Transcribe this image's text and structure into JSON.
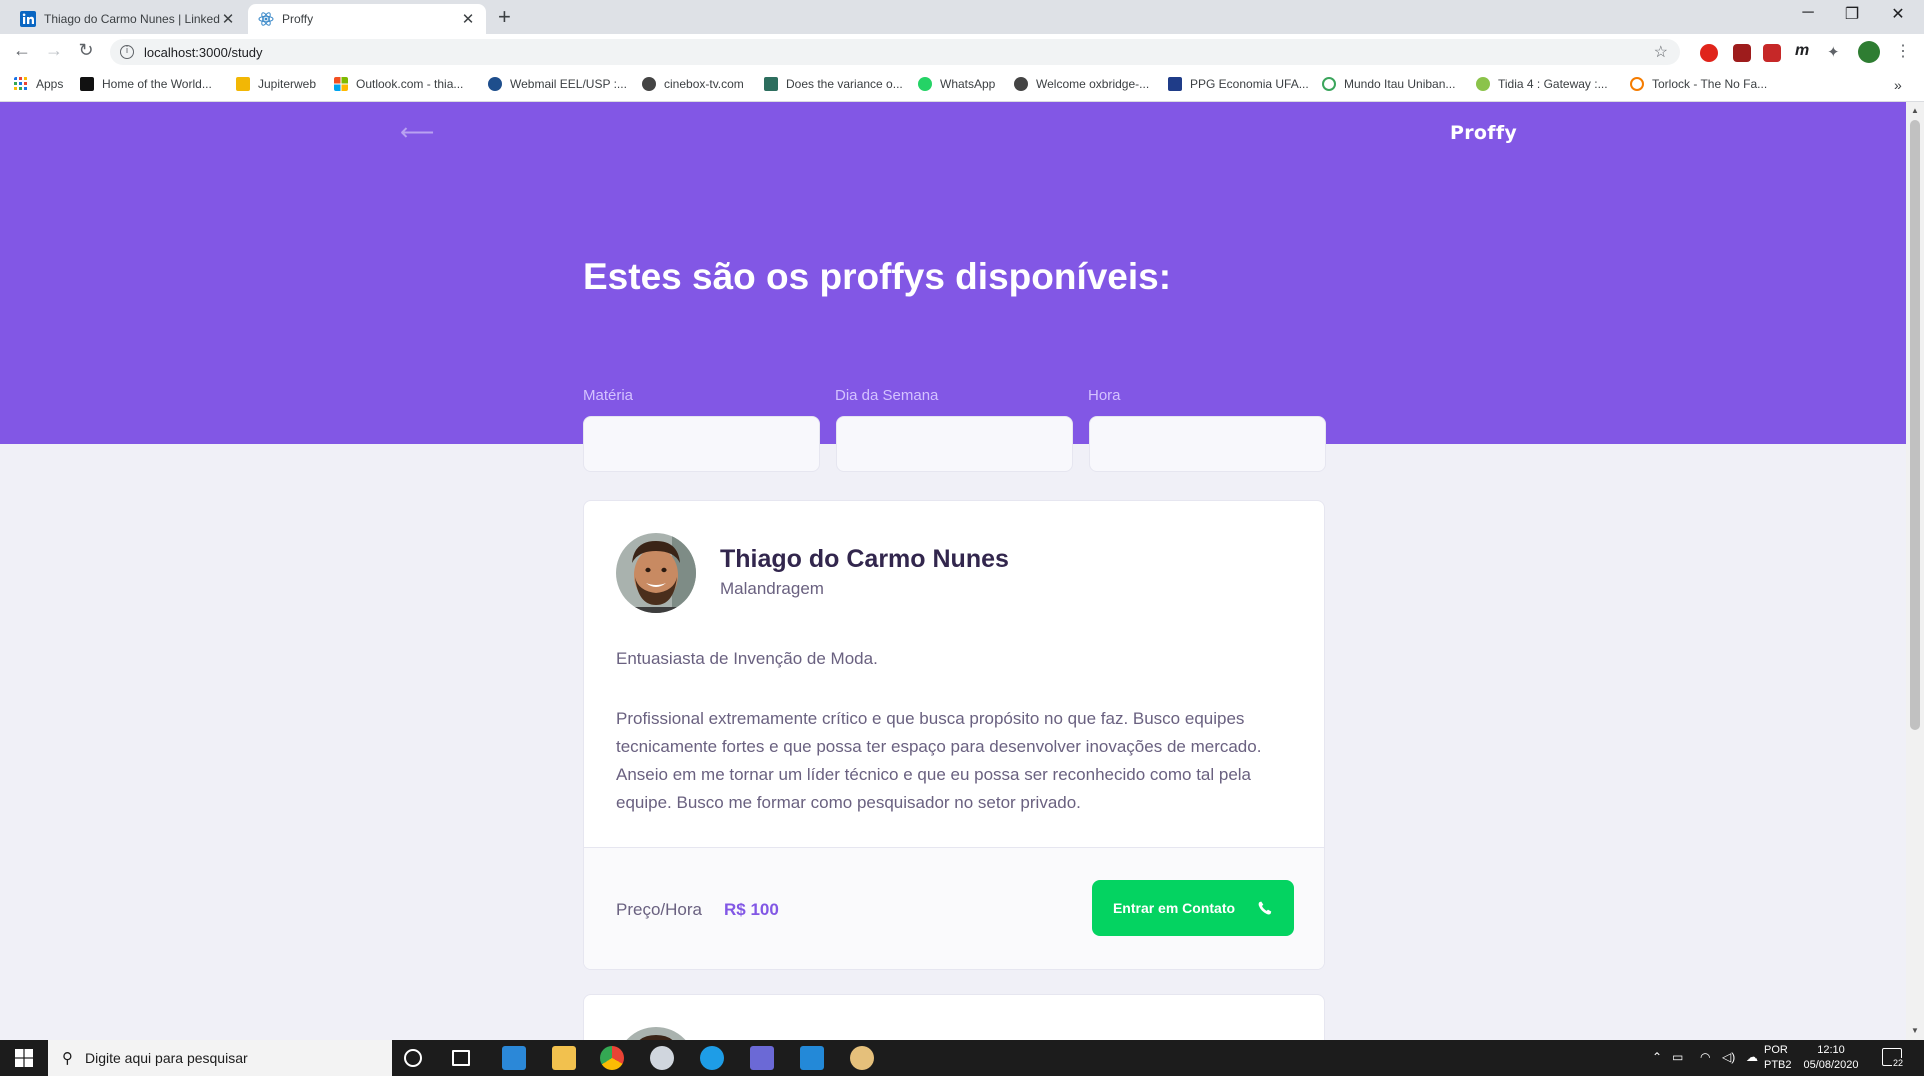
{
  "browser": {
    "tabs": [
      {
        "title": "Thiago do Carmo Nunes | LinkedIn",
        "favicon": "linkedin-icon",
        "active": false
      },
      {
        "title": "Proffy",
        "favicon": "react-icon",
        "active": true
      }
    ],
    "url": "localhost:3000/study",
    "bookmarks": [
      {
        "label": "Apps",
        "icon": "apps-grid-icon"
      },
      {
        "label": "Home of the World...",
        "icon": "bookmark-icon"
      },
      {
        "label": "Jupiterweb",
        "icon": "usp-icon"
      },
      {
        "label": "Outlook.com - thia...",
        "icon": "microsoft-icon"
      },
      {
        "label": "Webmail EEL/USP :...",
        "icon": "globe-icon"
      },
      {
        "label": "cinebox-tv.com",
        "icon": "globe-icon"
      },
      {
        "label": "Does the variance o...",
        "icon": "stackexchange-icon"
      },
      {
        "label": "WhatsApp",
        "icon": "whatsapp-icon"
      },
      {
        "label": "Welcome oxbridge-...",
        "icon": "globe-icon"
      },
      {
        "label": "PPG Economia UFA...",
        "icon": "bookmark-icon"
      },
      {
        "label": "Mundo Itau Uniban...",
        "icon": "globe-icon"
      },
      {
        "label": "Tidia 4 : Gateway :...",
        "icon": "tidia-icon"
      },
      {
        "label": "Torlock - The No Fa...",
        "icon": "torlock-icon"
      }
    ]
  },
  "page": {
    "logo": "Proffy",
    "title": "Estes são os proffys disponíveis:",
    "filters": {
      "subject_label": "Matéria",
      "weekday_label": "Dia da Semana",
      "time_label": "Hora"
    },
    "teachers": [
      {
        "name": "Thiago do Carmo Nunes",
        "subject": "Malandragem",
        "bio_intro": "Entuasiasta de Invenção de Moda.",
        "bio": "Profissional extremamente crítico e que busca propósito no que faz. Busco equipes tecnicamente fortes e que possa ter espaço para desenvolver inovações de mercado. Anseio em me tornar um líder técnico e que eu possa ser reconhecido como tal pela equipe. Busco me formar como pesquisador no setor privado.",
        "price_label": "Preço/Hora",
        "price": "R$ 100",
        "contact_label": "Entrar em Contato"
      }
    ]
  },
  "taskbar": {
    "search_placeholder": "Digite aqui para pesquisar",
    "language": "POR",
    "layout": "PTB2",
    "time": "12:10",
    "date": "05/08/2020",
    "notification_count": "22"
  },
  "colors": {
    "primary": "#8257E5",
    "secondary": "#04D361",
    "background": "#F0F0F7"
  }
}
